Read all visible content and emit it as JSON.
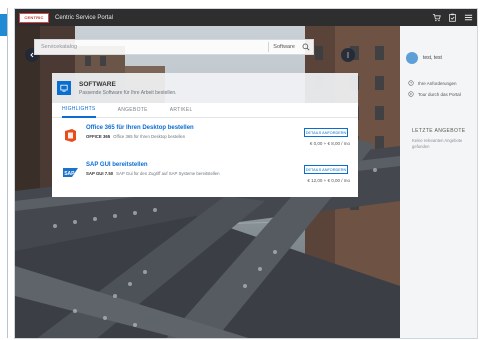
{
  "app": {
    "logo_text": "CENTRIC",
    "title": "Centric Service Portal"
  },
  "topbar": {
    "icons": [
      "cart-icon",
      "clipboard-check-icon",
      "menu-icon"
    ]
  },
  "search": {
    "placeholder": "Servicekatalog",
    "scope": "Software"
  },
  "category": {
    "title": "SOFTWARE",
    "subtitle": "Passende Software für Ihre Arbeit bestellen."
  },
  "tabs": [
    {
      "label": "HIGHLIGHTS",
      "active": true
    },
    {
      "label": "ANGEBOTE",
      "active": false
    },
    {
      "label": "ARTIKEL",
      "active": false
    }
  ],
  "items": [
    {
      "title": "Office 365 für Ihren Desktop bestellen",
      "code": "OFFICE 365",
      "description": "Office 365 für Ihren Desktop bestellen",
      "button": "DETAILS ANFORDERN",
      "price": "€ 0,00 + € 8,00 / mo",
      "icon": "office-icon"
    },
    {
      "title": "SAP GUI bereitstellen",
      "code": "SAP GUI 7.50",
      "description": "SAP Gui für den Zugriff auf SAP Systeme bereitstellen",
      "button": "DETAILS ANFORDERN",
      "price": "€ 12,00 + € 0,00 / mo",
      "icon": "sap-icon"
    }
  ],
  "sidepanel": {
    "user_name": "test, test",
    "links": [
      {
        "label": "Ihre Anforderungen",
        "icon": "requests-icon"
      },
      {
        "label": "Tour durch das Portal",
        "icon": "tour-icon"
      }
    ],
    "recent_heading": "LETZTE ANGEBOTE",
    "recent_empty": "Keine relevanten Angebote gefunden"
  },
  "colors": {
    "accent": "#0a6ed1",
    "topbar": "#2e2e2e",
    "office": "#e74c1c",
    "sap": "#1a73c8"
  }
}
